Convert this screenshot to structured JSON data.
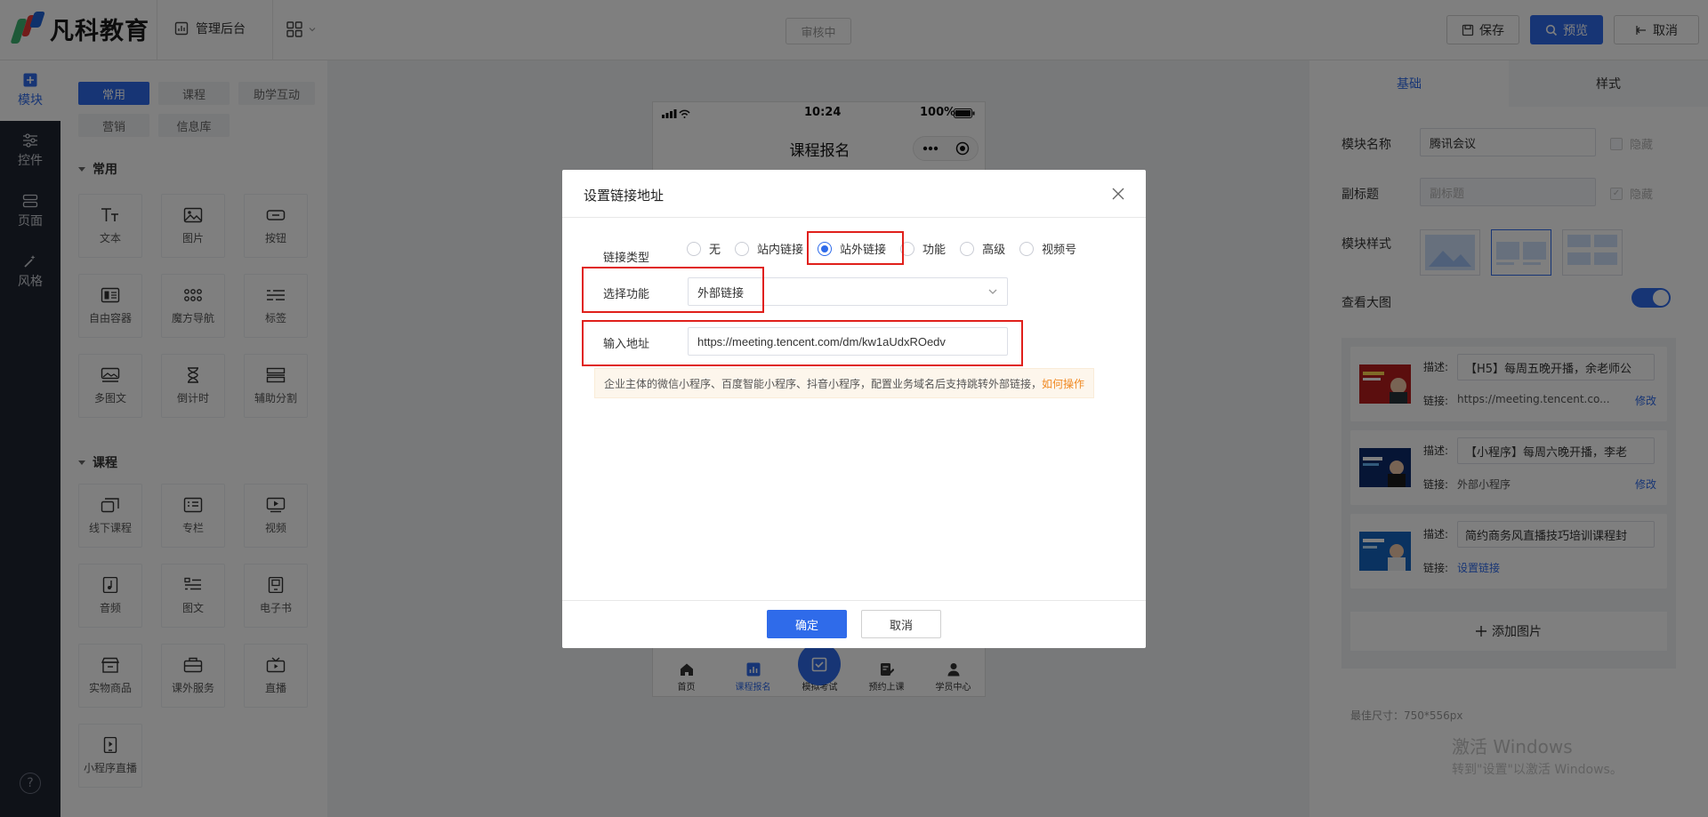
{
  "header": {
    "brand": "凡科教育",
    "admin_link": "管理后台",
    "review_status": "审核中",
    "save": "保存",
    "preview": "预览",
    "cancel": "取消"
  },
  "rail": {
    "items": [
      {
        "label": "模块",
        "icon": "plus-square-icon"
      },
      {
        "label": "控件",
        "icon": "sliders-icon"
      },
      {
        "label": "页面",
        "icon": "pages-icon"
      },
      {
        "label": "风格",
        "icon": "magic-wand-icon"
      }
    ],
    "help": "?"
  },
  "components": {
    "filters": [
      "常用",
      "课程",
      "助学互动",
      "营销",
      "信息库"
    ],
    "sections": [
      {
        "title": "常用",
        "items": [
          "文本",
          "图片",
          "按钮",
          "自由容器",
          "魔方导航",
          "标签",
          "多图文",
          "倒计时",
          "辅助分割"
        ]
      },
      {
        "title": "课程",
        "items": [
          "线下课程",
          "专栏",
          "视频",
          "音频",
          "图文",
          "电子书",
          "实物商品",
          "课外服务",
          "直播",
          "小程序直播"
        ]
      }
    ]
  },
  "phone": {
    "time": "10:24",
    "battery": "100%",
    "nav_title": "课程报名",
    "tabs": [
      "首页",
      "课程报名",
      "模拟考试",
      "预约上课",
      "学员中心"
    ]
  },
  "right_panel": {
    "tabs": [
      "基础",
      "样式"
    ],
    "module_name_label": "模块名称",
    "module_name": "腾讯会议",
    "hide": "隐藏",
    "subtitle_label": "副标题",
    "subtitle_placeholder": "副标题",
    "style_label": "模块样式",
    "view_large_label": "查看大图",
    "desc_label": "描述:",
    "link_label": "链接:",
    "edit": "修改",
    "images": [
      {
        "desc": "【H5】每周五晚开播，余老师公",
        "link": "https://meeting.tencent.co...",
        "editable": true
      },
      {
        "desc": "【小程序】每周六晚开播，李老",
        "link": "外部小程序",
        "editable": true
      },
      {
        "desc": "简约商务风直播技巧培训课程封",
        "link": "设置链接",
        "editable": false
      }
    ],
    "add_image": "添加图片",
    "size_note": "最佳尺寸：750*556px"
  },
  "watermark": {
    "line1": "激活 Windows",
    "line2": "转到\"设置\"以激活 Windows。"
  },
  "modal": {
    "title": "设置链接地址",
    "link_type_label": "链接类型",
    "link_types": [
      "无",
      "站内链接",
      "站外链接",
      "功能",
      "高级",
      "视频号"
    ],
    "selected_link_type": "站外链接",
    "select_function_label": "选择功能",
    "select_function_value": "外部链接",
    "address_label": "输入地址",
    "address_value": "https://meeting.tencent.com/dm/kw1aUdxROedv",
    "tip": "企业主体的微信小程序、百度智能小程序、抖音小程序，配置业务域名后支持跳转外部链接，",
    "tip_link": "如何操作",
    "ok": "确定",
    "cancel": "取消"
  },
  "colors": {
    "primary": "#2f6bea",
    "highlight": "#e0201b",
    "rail_bg": "#1f2430"
  }
}
